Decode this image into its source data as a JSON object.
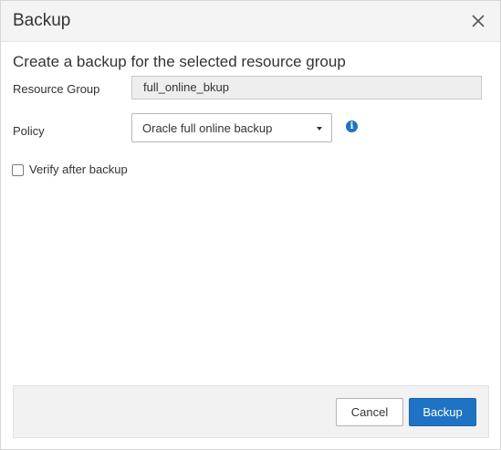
{
  "dialog": {
    "title": "Backup",
    "close_icon": "close-icon"
  },
  "form": {
    "heading": "Create a backup for the selected resource group",
    "resource_group_label": "Resource Group",
    "resource_group_value": "full_online_bkup",
    "policy_label": "Policy",
    "policy_selected": "Oracle full online backup",
    "policy_info_icon": "info-icon",
    "verify_label": "Verify after backup",
    "verify_checked": false
  },
  "footer": {
    "cancel_label": "Cancel",
    "backup_label": "Backup"
  },
  "colors": {
    "primary": "#1f73c4",
    "titlebar_bg": "#f4f4f4",
    "footer_bg": "#f2f2f2",
    "readonly_field_bg": "#eeeeee"
  }
}
